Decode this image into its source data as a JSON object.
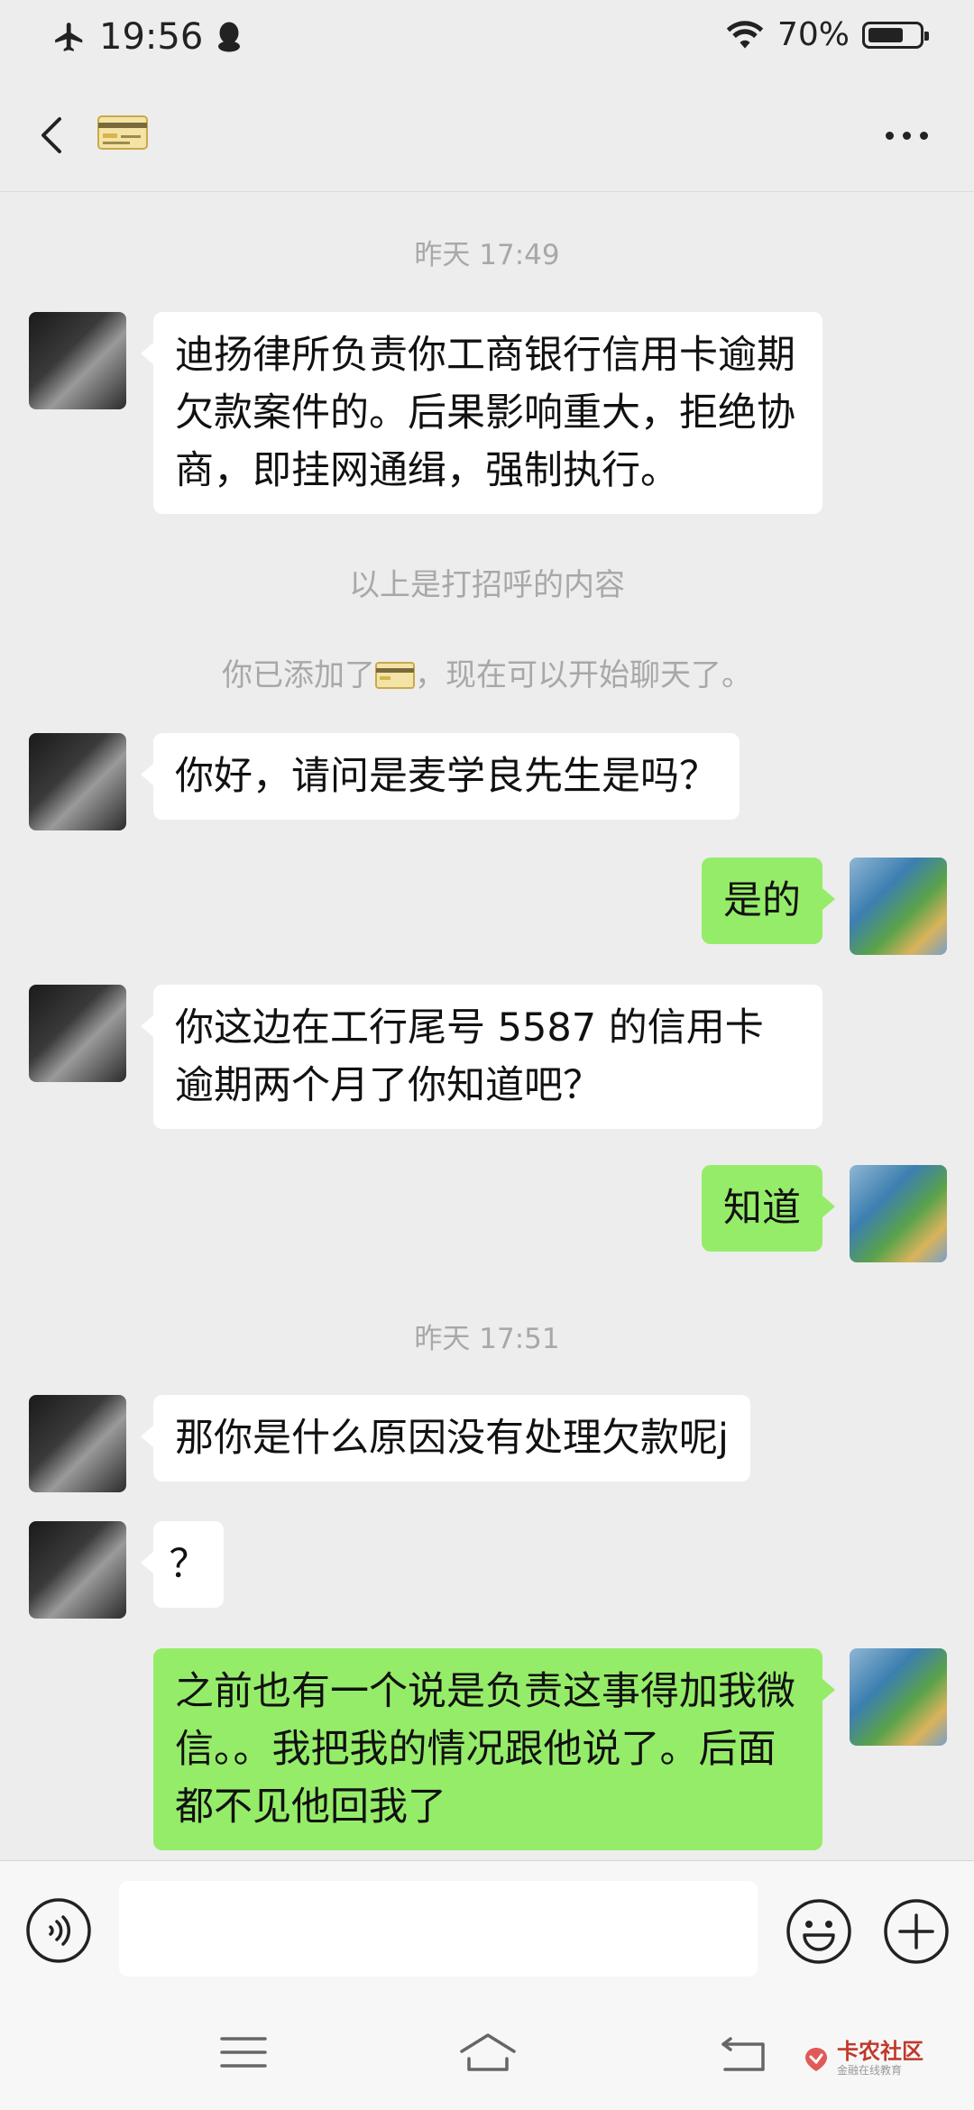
{
  "status_bar": {
    "time": "19:56",
    "battery_text": "70%",
    "battery_level": 0.7
  },
  "nav": {
    "title_icon": "credit-card-emoji",
    "back_icon": "chevron-left-icon",
    "more_icon": "more-horizontal-icon"
  },
  "chat": {
    "timestamp_1": "昨天 17:49",
    "msg_1": "迪扬律所负责你工商银行信用卡逾期欠款案件的。后果影响重大，拒绝协商，即挂网通缉，强制执行。",
    "system_1": "以上是打招呼的内容",
    "system_2_prefix": "你已添加了",
    "system_2_suffix": "，现在可以开始聊天了。",
    "msg_2": "你好，请问是麦学良先生是吗？",
    "msg_3": "是的",
    "msg_4": "你这边在工行尾号 5587 的信用卡逾期两个月了你知道吧？",
    "msg_5": "知道",
    "timestamp_2": "昨天 17:51",
    "msg_6": "那你是什么原因没有处理欠款呢j",
    "msg_7": "？",
    "msg_8": "之前也有一个说是负责这事得加我微信。。我把我的情况跟他说了。后面都不见他回我了"
  },
  "input": {
    "value": "",
    "voice_icon": "voice-icon",
    "emoji_icon": "emoji-icon",
    "plus_icon": "plus-icon"
  },
  "watermark": {
    "text": "卡农社区",
    "sub": "金融在线教育"
  },
  "colors": {
    "background": "#ededed",
    "incoming_bubble": "#ffffff",
    "outgoing_bubble": "#95ec69",
    "meta_text": "#a8a8a8"
  }
}
